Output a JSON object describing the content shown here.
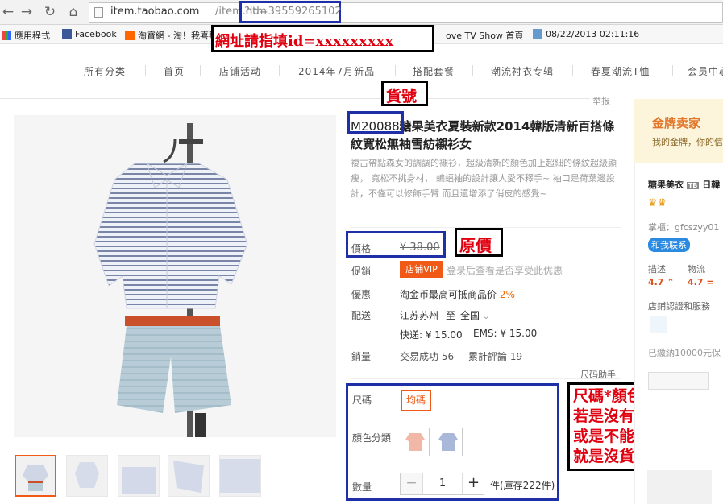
{
  "browser": {
    "url_host": "item.taobao.com",
    "url_path": "/item.htm",
    "url_query": "?id=39559265102",
    "back_icon": "arrow-left-icon",
    "forward_icon": "arrow-right-icon",
    "reload_icon": "reload-icon",
    "home_icon": "home-icon"
  },
  "bookmarks": [
    {
      "label": "應用程式"
    },
    {
      "label": "Facebook"
    },
    {
      "label": "淘寶網 - 淘！我喜歡"
    },
    {
      "label": "ove TV Show 首頁"
    },
    {
      "label": "08/22/2013 02:11:16"
    }
  ],
  "nav": [
    "所有分类",
    "首页",
    "店铺活动",
    "2014年7月新品",
    "搭配套餐",
    "潮流衬衣专辑",
    "春夏潮流T恤",
    "会员中心"
  ],
  "report_label": "举报",
  "product": {
    "code": "M20088",
    "title_rest": "糖果美衣夏裝新款2014韓版清新百搭條紋寬松無袖雪紡襯衫女",
    "description": "複古帶點森女的調調的襯衫，超級清新的顏色加上超細的條紋超級顯瘦， 寬松不挑身材， 蝙蝠袖的設計讓人愛不釋手~ 袖口是荷葉邊設計，不僅可以修飾手臂 而且還增添了俏皮的感覺~",
    "price_label": "價格",
    "price": "¥ 38.00",
    "promo_label": "促銷",
    "promo_badge": "店铺VIP",
    "promo_note": "登录后查看是否享受此优惠",
    "offer_label": "優惠",
    "offer_text": "淘金币最高可抵商品价",
    "offer_pct": "2%",
    "ship_label": "配送",
    "ship_from": "江苏苏州",
    "ship_to_word": "至",
    "ship_to": "全国",
    "ship_express": "快递: ¥ 15.00",
    "ship_ems": "EMS: ¥ 15.00",
    "sales_label": "銷量",
    "sales_count": "交易成功 56",
    "reviews": "累計評論 19",
    "size_helper": "尺码助手",
    "size_label": "尺碼",
    "size_option": "均碼",
    "color_label": "顏色分類",
    "qty_label": "數量",
    "qty_value": "1",
    "stock": "件(庫存222件)"
  },
  "right_panel": {
    "gold_title": "金牌卖家",
    "gold_sub": "我的金牌，你的信賴",
    "shop_name": "糖果美衣",
    "tb_badge": "TB",
    "shop_extra": "日韓",
    "owner": "掌櫃：gfcszyy01",
    "contact": "和我联系",
    "desc_label": "描述",
    "desc_score": "4.7",
    "logistics_label": "物流",
    "logistics_score": "4.7",
    "cert_label": "店鋪認證和服務",
    "deposit": "已繳納10000元保"
  },
  "annotations": {
    "url_note": "網址請指填id=xxxxxxxxx",
    "code_note": "貨號",
    "price_note": "原價",
    "variant_note_1": "尺碼*顏色",
    "variant_note_2": "若是沒有出現,",
    "variant_note_3": "或是不能點選",
    "variant_note_4": "就是沒貨了!!"
  },
  "colors": {
    "accent": "#f05a16",
    "annotation_red": "#e0000f",
    "annotation_blue": "#1e2fa8",
    "gold_bg": "#fdf4dc"
  }
}
